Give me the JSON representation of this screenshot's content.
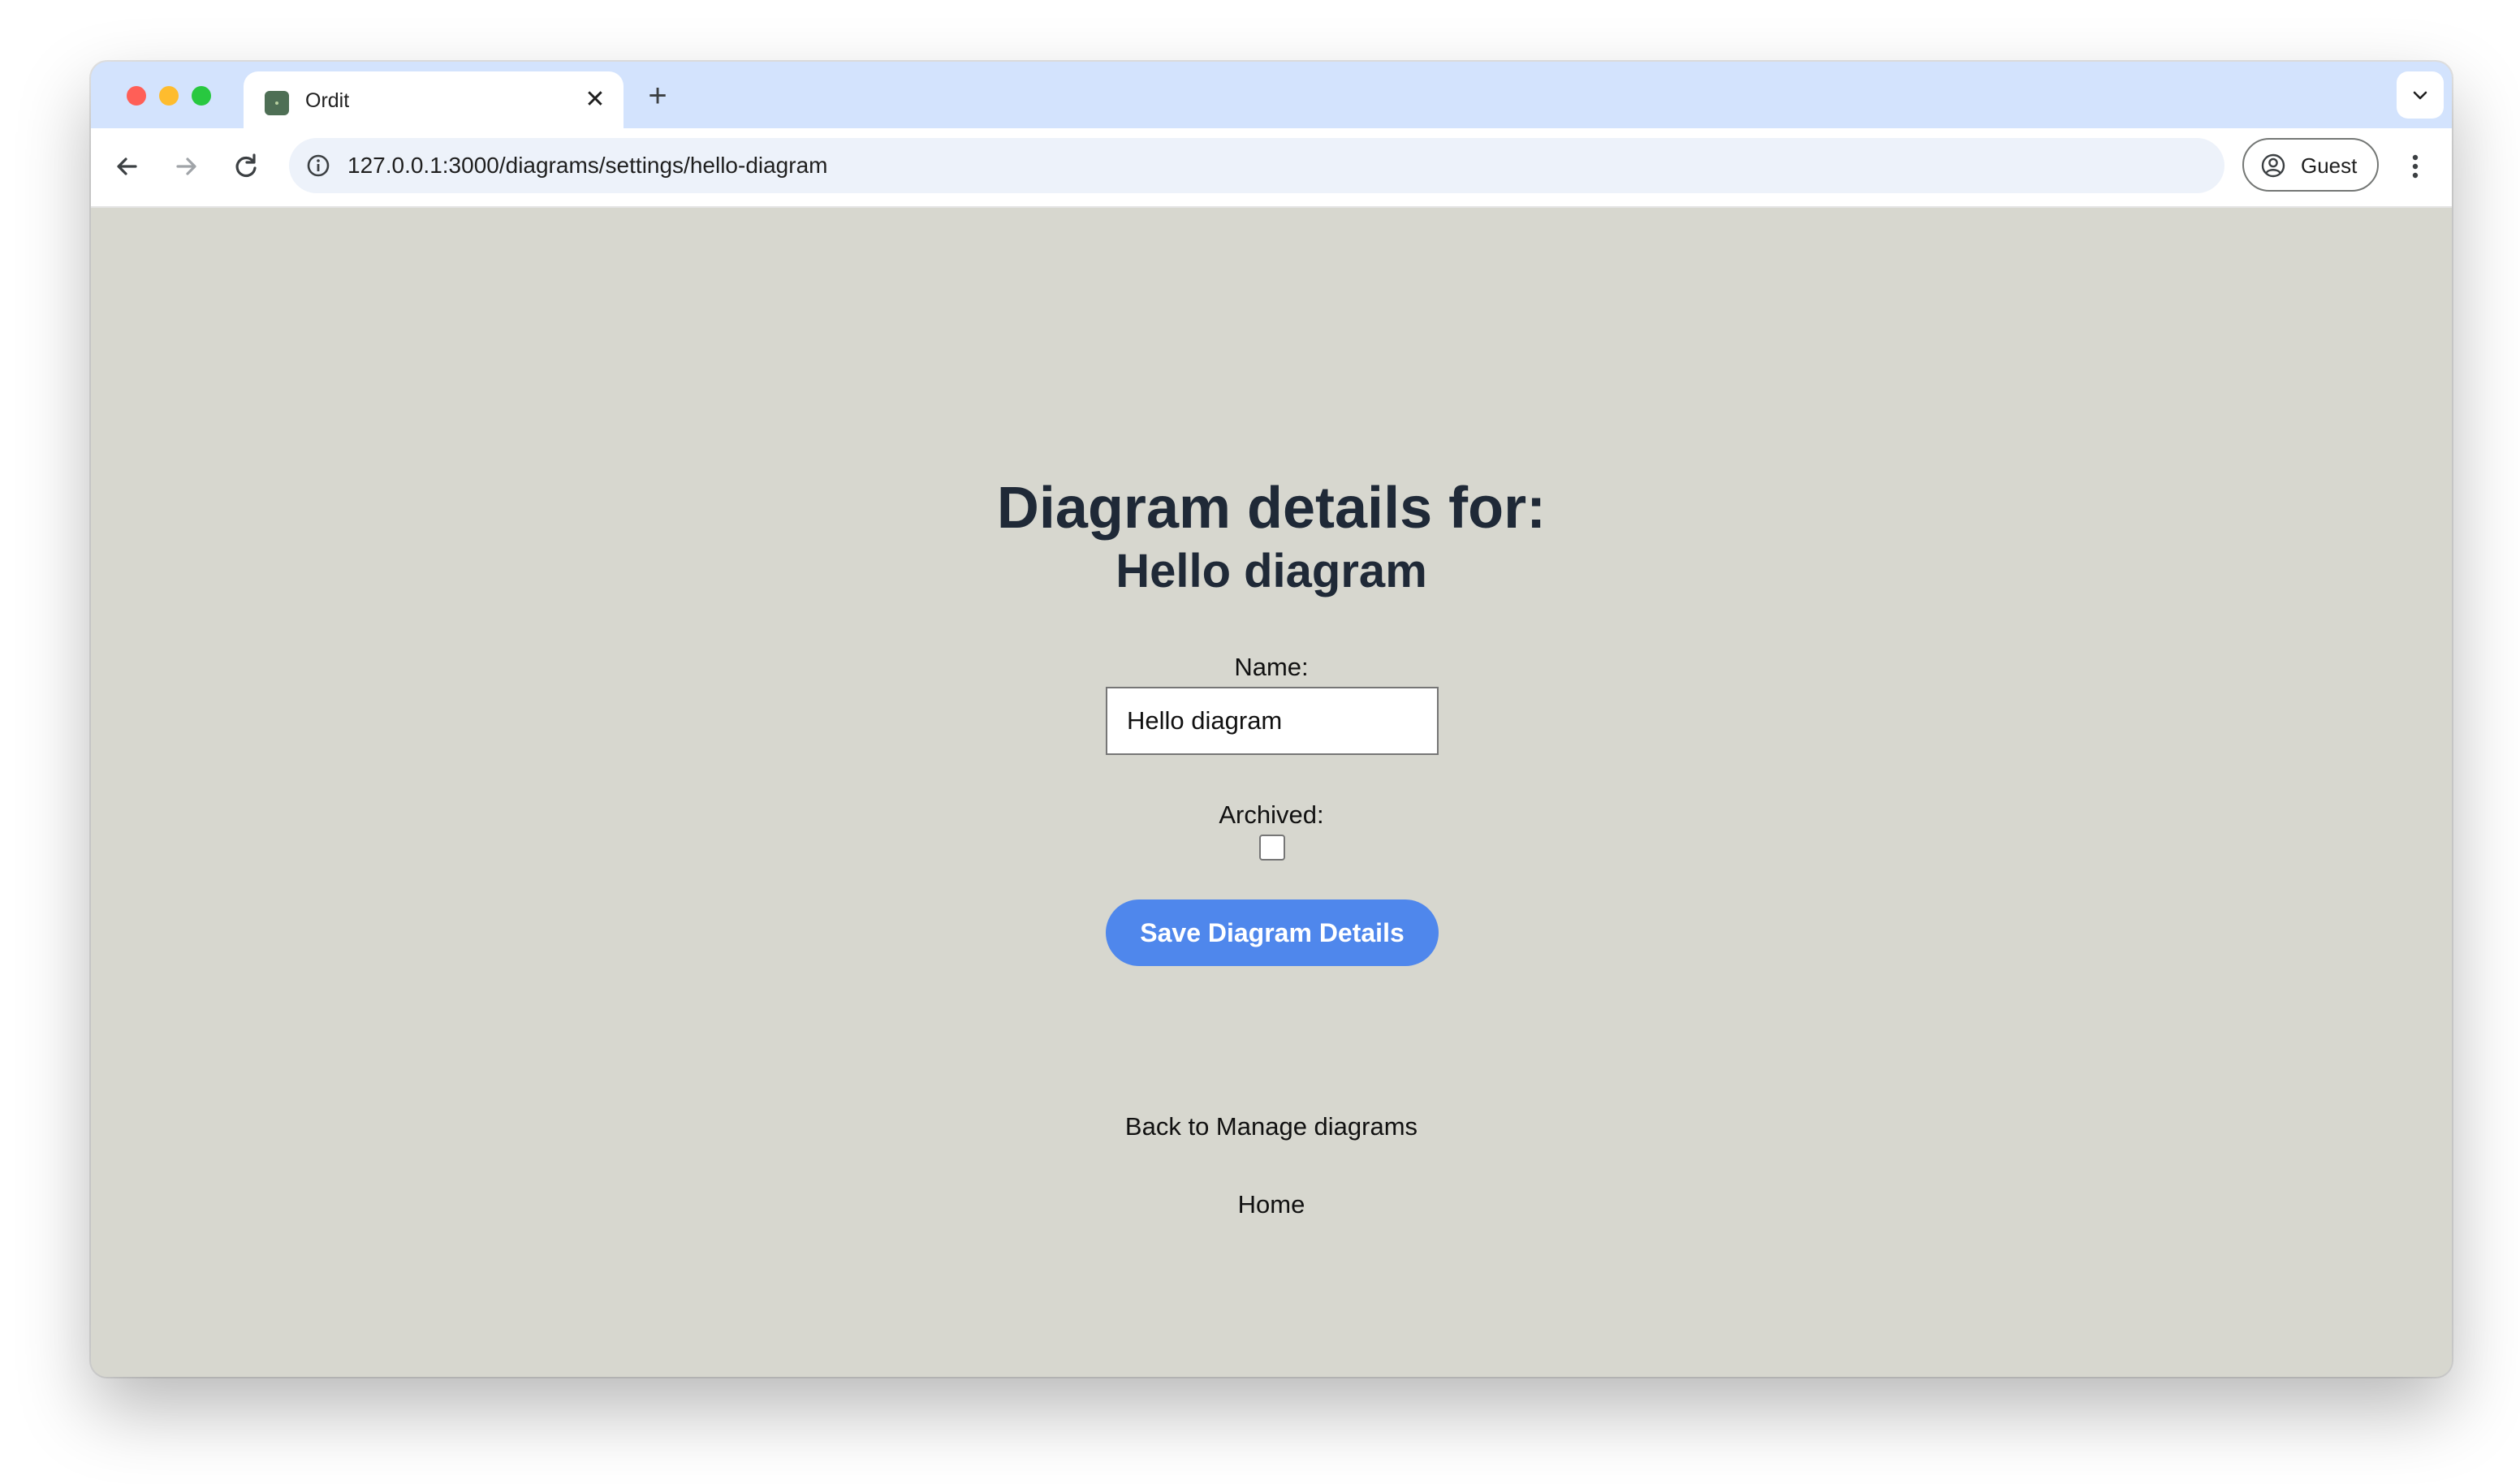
{
  "browser": {
    "tab_title": "Ordit",
    "tab_close_glyph": "✕",
    "new_tab_glyph": "+",
    "url": "127.0.0.1:3000/diagrams/settings/hello-diagram",
    "profile_label": "Guest"
  },
  "page": {
    "heading": "Diagram details for:",
    "subheading": "Hello diagram",
    "name_label": "Name:",
    "name_value": "Hello diagram",
    "archived_label": "Archived:",
    "archived_checked": false,
    "save_label": "Save Diagram Details",
    "back_link": "Back to Manage diagrams",
    "home_link": "Home"
  },
  "colors": {
    "page_background": "#d7d7cf",
    "heading_text": "#1f2937",
    "save_button": "#4f87ec",
    "tabstrip": "#d3e3fd",
    "omnibox": "#edf2fa"
  },
  "icons": {
    "back": "arrow-left-icon",
    "forward": "arrow-right-icon",
    "reload": "reload-icon",
    "site_info": "info-icon",
    "profile": "account-circle-icon",
    "menu": "kebab-menu-icon",
    "tab_list": "chevron-down-icon"
  }
}
